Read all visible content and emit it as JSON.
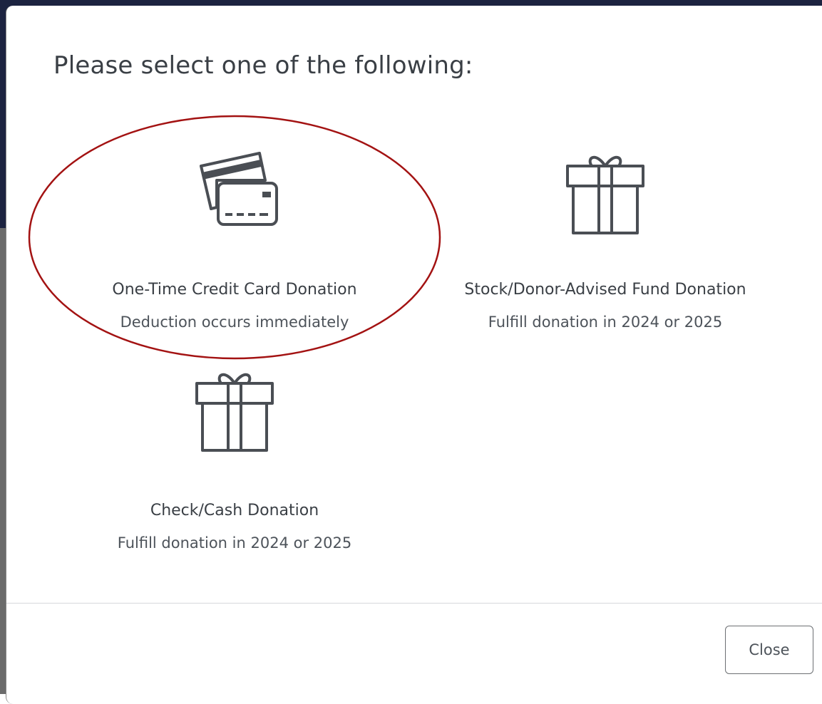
{
  "modal": {
    "title": "Please select one of the following:",
    "options": [
      {
        "title": "One-Time Credit Card Donation",
        "subtitle": "Deduction occurs immediately",
        "icon": "credit-card-icon"
      },
      {
        "title": "Stock/Donor-Advised Fund Donation",
        "subtitle": "Fulfill donation in 2024 or 2025",
        "icon": "gift-icon"
      },
      {
        "title": "Check/Cash Donation",
        "subtitle": "Fulfill donation in 2024 or 2025",
        "icon": "gift-icon"
      }
    ],
    "close_label": "Close"
  },
  "colors": {
    "text": "#3a3f45",
    "icon_stroke": "#4a4e54",
    "highlight": "#a31212",
    "backdrop": "#1c2340"
  }
}
